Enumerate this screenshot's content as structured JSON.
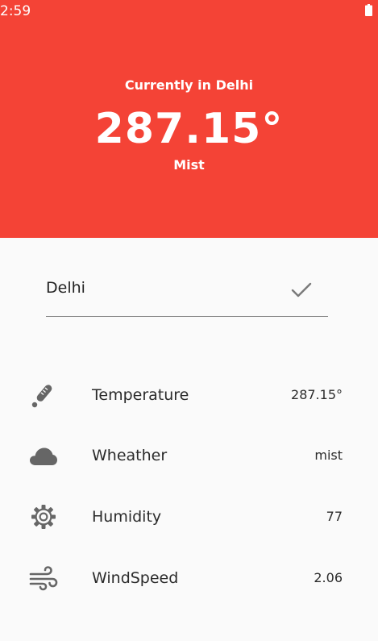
{
  "status_bar": {
    "time": "2:59"
  },
  "header": {
    "current_label": "Currently in Delhi",
    "temperature": "287.15°",
    "description": "Mist",
    "color": "#f44336"
  },
  "search": {
    "value": "Delhi",
    "confirm_icon": "check-icon"
  },
  "details": [
    {
      "icon": "thermometer-icon",
      "label": "Temperature",
      "value": "287.15°"
    },
    {
      "icon": "cloud-icon",
      "label": "Wheather",
      "value": "mist"
    },
    {
      "icon": "gear-icon",
      "label": "Humidity",
      "value": "77"
    },
    {
      "icon": "wind-icon",
      "label": "WindSpeed",
      "value": "2.06"
    }
  ]
}
